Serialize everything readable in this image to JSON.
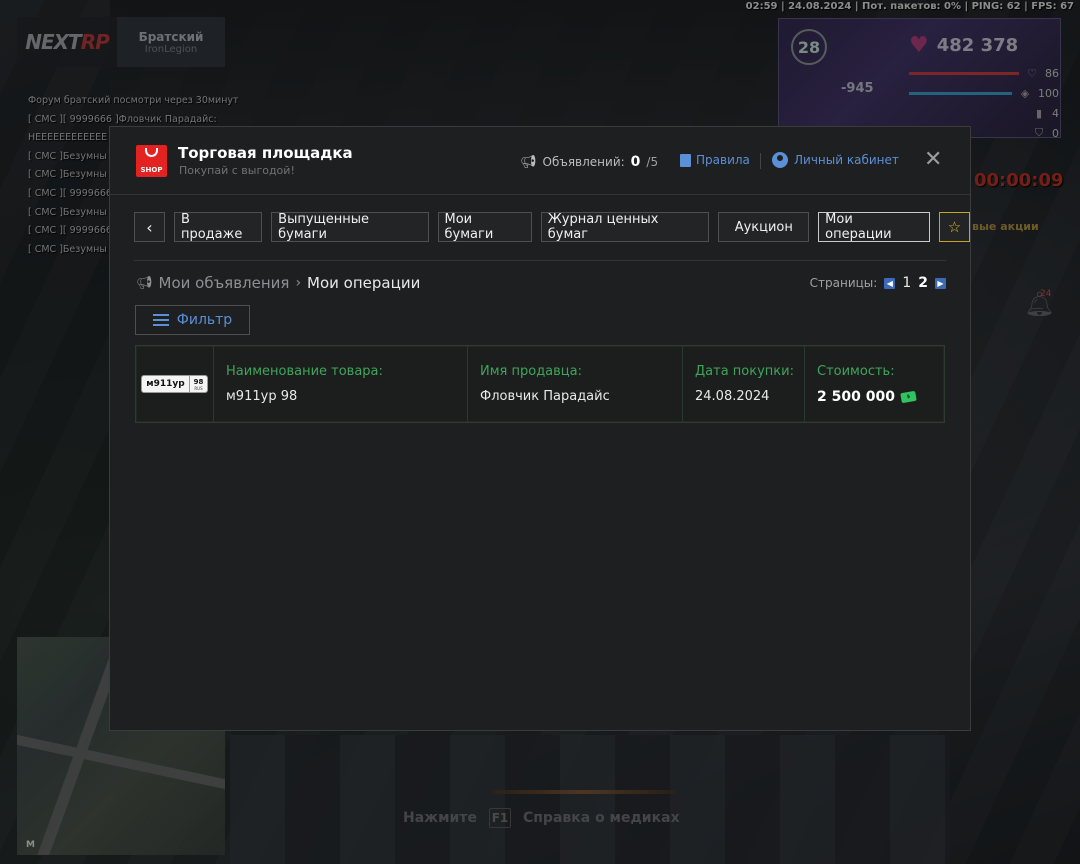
{
  "status_line": "02:59 | 24.08.2024 | Пот. пакетов: 0% | PING: 62 | FPS: 67",
  "server": {
    "brand_a": "NEXT",
    "brand_b": "RP",
    "name": "Братский",
    "sub": "IronLegion"
  },
  "chat": [
    "Форум братский посмотри через 30минут",
    "[ СМС ][ 9999666 ]Фловчик Парадайс:",
    "НЕЕЕЕЕЕЕЕЕЕЕЕ",
    "[ СМС ]Безумны",
    "[ СМС ]Безумны",
    "[ СМС ][ 9999666",
    "[ СМС ]Безумны",
    "[ СМС ][ 9999666",
    "[ СМС ]Безумны"
  ],
  "hud": {
    "level": "28",
    "money": "482 378",
    "delta": "-945",
    "health": "86",
    "armor": "100",
    "stat3": "4",
    "stat4": "0"
  },
  "timer": "00:00:09",
  "side_text": "вые акции",
  "bell_count": "24",
  "hint": {
    "prefix": "Нажмите",
    "key": "F1",
    "text": "Справка о медиках"
  },
  "minimap_label": "M",
  "modal": {
    "title": "Торговая площадка",
    "subtitle": "Покупай с выгодой!",
    "shop_logo_text": "SHOP",
    "ads_label": "Объявлений:",
    "ads_count": "0",
    "ads_max": "/5",
    "rules": "Правила",
    "cabinet": "Личный кабинет",
    "close": "✕"
  },
  "tabs": [
    {
      "label": "В продаже"
    },
    {
      "label": "Выпущенные бумаги"
    },
    {
      "label": "Мои бумаги"
    },
    {
      "label": "Журнал ценных бумаг"
    },
    {
      "label": "Аукцион"
    },
    {
      "label": "Мои операции",
      "active": true
    }
  ],
  "breadcrumb": {
    "parent": "Мои объявления",
    "current": "Мои операции"
  },
  "pagination": {
    "label": "Страницы:",
    "pages": [
      "1",
      "2"
    ],
    "current": "2"
  },
  "filter_label": "Фильтр",
  "item": {
    "plate_number": "м911ур",
    "plate_region": "98",
    "plate_country": "RUS",
    "columns": [
      {
        "header": "Наименование товара:",
        "value": "м911ур 98"
      },
      {
        "header": "Имя продавца:",
        "value": "Фловчик Парадайс"
      },
      {
        "header": "Дата покупки:",
        "value": "24.08.2024"
      },
      {
        "header": "Стоимость:",
        "value": "2 500 000"
      }
    ]
  },
  "colors": {
    "accent_blue": "#5b8fd6",
    "accent_green": "#3fa45b",
    "shop_red": "#e32222",
    "star_gold": "#e3bb24"
  }
}
